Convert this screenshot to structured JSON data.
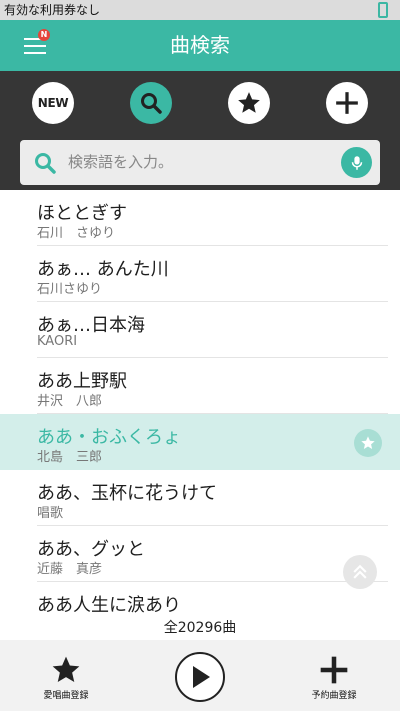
{
  "status_bar": {
    "text": "有効な利用券なし"
  },
  "header": {
    "title": "曲検索",
    "menu_badge": "N"
  },
  "toolbar": {
    "new_label": "NEW"
  },
  "search": {
    "placeholder": "検索語を入力。"
  },
  "songs": [
    {
      "title": "ほととぎす",
      "artist": "石川　さゆり"
    },
    {
      "title": "あぁ… あんた川",
      "artist": "石川さゆり"
    },
    {
      "title": "あぁ…日本海",
      "artist": "KAORI"
    },
    {
      "title": "ああ上野駅",
      "artist": "井沢　八郎"
    },
    {
      "title": "ああ・おふくろょ",
      "artist": "北島　三郎",
      "favorite": true
    },
    {
      "title": "ああ、玉杯に花うけて",
      "artist": "唱歌"
    },
    {
      "title": "ああ、グッと",
      "artist": "近藤　真彦"
    },
    {
      "title": "ああ人生に涙あり",
      "artist": ""
    }
  ],
  "total_count": "全20296曲",
  "bottom": {
    "favorite_label": "愛唱曲登録",
    "reserve_label": "予約曲登録"
  },
  "colors": {
    "accent": "#3bb8a4",
    "toolbar_bg": "#363636",
    "highlight": "#d3eeea"
  }
}
